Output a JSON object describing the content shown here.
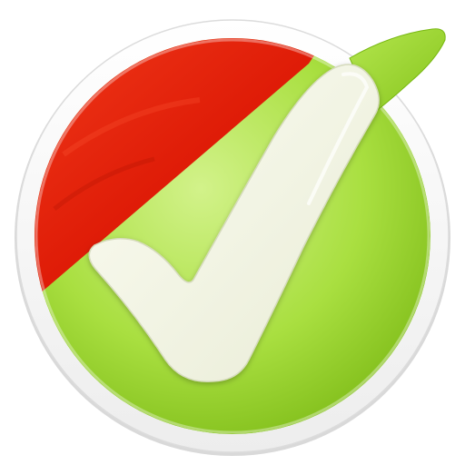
{
  "app_icon": {
    "name": "checkmark-app-icon",
    "colors": {
      "background": "#ffffff",
      "ring_outer": "#e4e4e4",
      "ring_inner": "#fbfbfb",
      "ring_shadow": "#cfcfcf",
      "red_light": "#f43a1a",
      "red_mid": "#e01a04",
      "red_dark": "#b51000",
      "green_light": "#c8ee78",
      "green_mid": "#a6de3c",
      "green_dark": "#78b812",
      "check_fill": "#f3f4e6",
      "check_edge": "#dde1c8",
      "tail_green": "#96d22a"
    }
  }
}
